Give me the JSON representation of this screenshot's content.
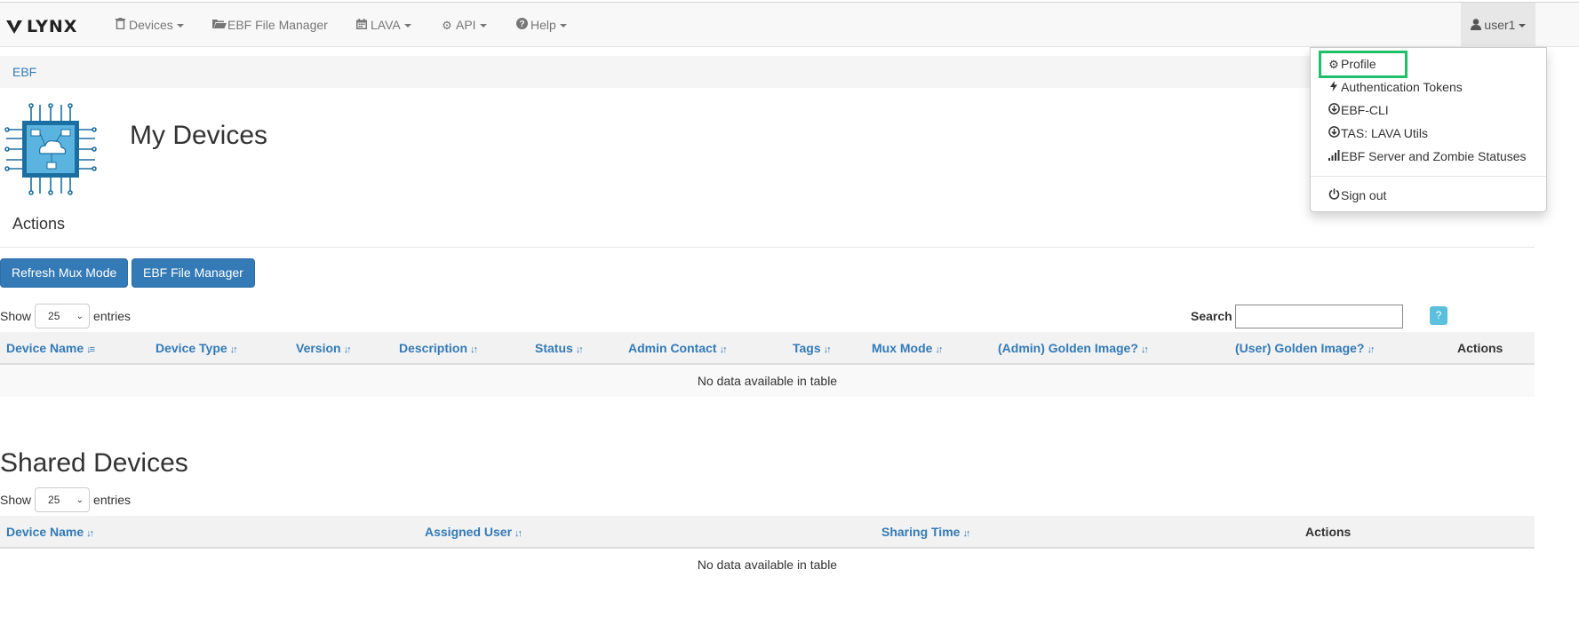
{
  "brand": {
    "name": "LYNX"
  },
  "nav": {
    "devices": "Devices",
    "file_manager": "EBF File Manager",
    "lava": "LAVA",
    "api": "API",
    "help": "Help",
    "user": "user1"
  },
  "user_menu": {
    "items": [
      "Profile",
      "Authentication Tokens",
      "EBF-CLI",
      "TAS: LAVA Utils",
      "EBF Server and Zombie Statuses"
    ],
    "sign_out": "Sign out"
  },
  "breadcrumb": {
    "label": "EBF"
  },
  "page_title": "My Devices",
  "actions_heading": "Actions",
  "buttons": {
    "refresh_mux": "Refresh Mux Mode",
    "file_manager": "EBF File Manager"
  },
  "my_devices": {
    "show_label": "Show",
    "page_size": "25",
    "entries_label": "entries",
    "search_label": "Search",
    "search_value": "",
    "help": "?",
    "columns": [
      "Device Name",
      "Device Type",
      "Version",
      "Description",
      "Status",
      "Admin Contact",
      "Tags",
      "Mux Mode",
      "(Admin) Golden Image?",
      "(User) Golden Image?",
      "Actions"
    ],
    "empty": "No data available in table"
  },
  "shared_title": "Shared Devices",
  "shared": {
    "show_label": "Show",
    "page_size": "25",
    "entries_label": "entries",
    "columns": [
      "Device Name",
      "Assigned User",
      "Sharing Time",
      "Actions"
    ],
    "empty": "No data available in table"
  },
  "colors": {
    "link": "#337ab7",
    "primary_button": "#337ab7",
    "highlight": "#1fbf6b",
    "info": "#5bc0de"
  }
}
